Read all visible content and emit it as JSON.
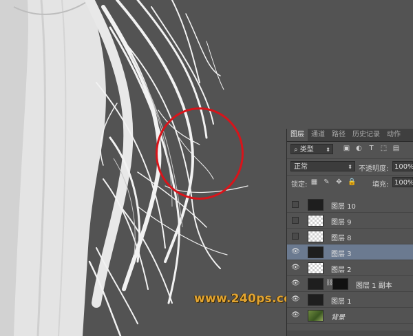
{
  "watermark": "www.240ps.com",
  "colors": {
    "highlight_circle": "#d8141a",
    "watermark": "#e2a431",
    "selected_layer": "#6b7a90"
  },
  "panel": {
    "tabs": [
      {
        "label": "图层",
        "active": true
      },
      {
        "label": "通道",
        "active": false
      },
      {
        "label": "路径",
        "active": false
      },
      {
        "label": "历史记录",
        "active": false
      },
      {
        "label": "动作",
        "active": false
      }
    ],
    "filter": {
      "label": "类型",
      "icons": [
        "image-filter-icon",
        "adjustment-filter-icon",
        "type-filter-icon",
        "shape-filter-icon",
        "smart-object-filter-icon"
      ]
    },
    "blend_mode": "正常",
    "opacity_label": "不透明度:",
    "opacity_value": "100%",
    "lock_label": "锁定:",
    "lock_icons": [
      "lock-transparent-icon",
      "lock-paint-icon",
      "lock-move-icon",
      "lock-all-icon"
    ],
    "fill_label": "填充:",
    "fill_value": "100%",
    "layers": [
      {
        "name": "图层 10",
        "visible": false,
        "thumb": "dark",
        "selected": false
      },
      {
        "name": "图层 9",
        "visible": false,
        "thumb": "checker",
        "selected": false
      },
      {
        "name": "图层 8",
        "visible": false,
        "thumb": "checker",
        "selected": false
      },
      {
        "name": "图层 3",
        "visible": true,
        "thumb": "dark",
        "selected": true
      },
      {
        "name": "图层 2",
        "visible": true,
        "thumb": "checker",
        "selected": false
      },
      {
        "name": "图层 1 副本",
        "visible": true,
        "thumb": "dark",
        "selected": false,
        "mask": true
      },
      {
        "name": "图层 1",
        "visible": true,
        "thumb": "dark",
        "selected": false
      },
      {
        "name": "背景",
        "visible": true,
        "thumb": "photo",
        "selected": false,
        "italic": true
      }
    ]
  }
}
